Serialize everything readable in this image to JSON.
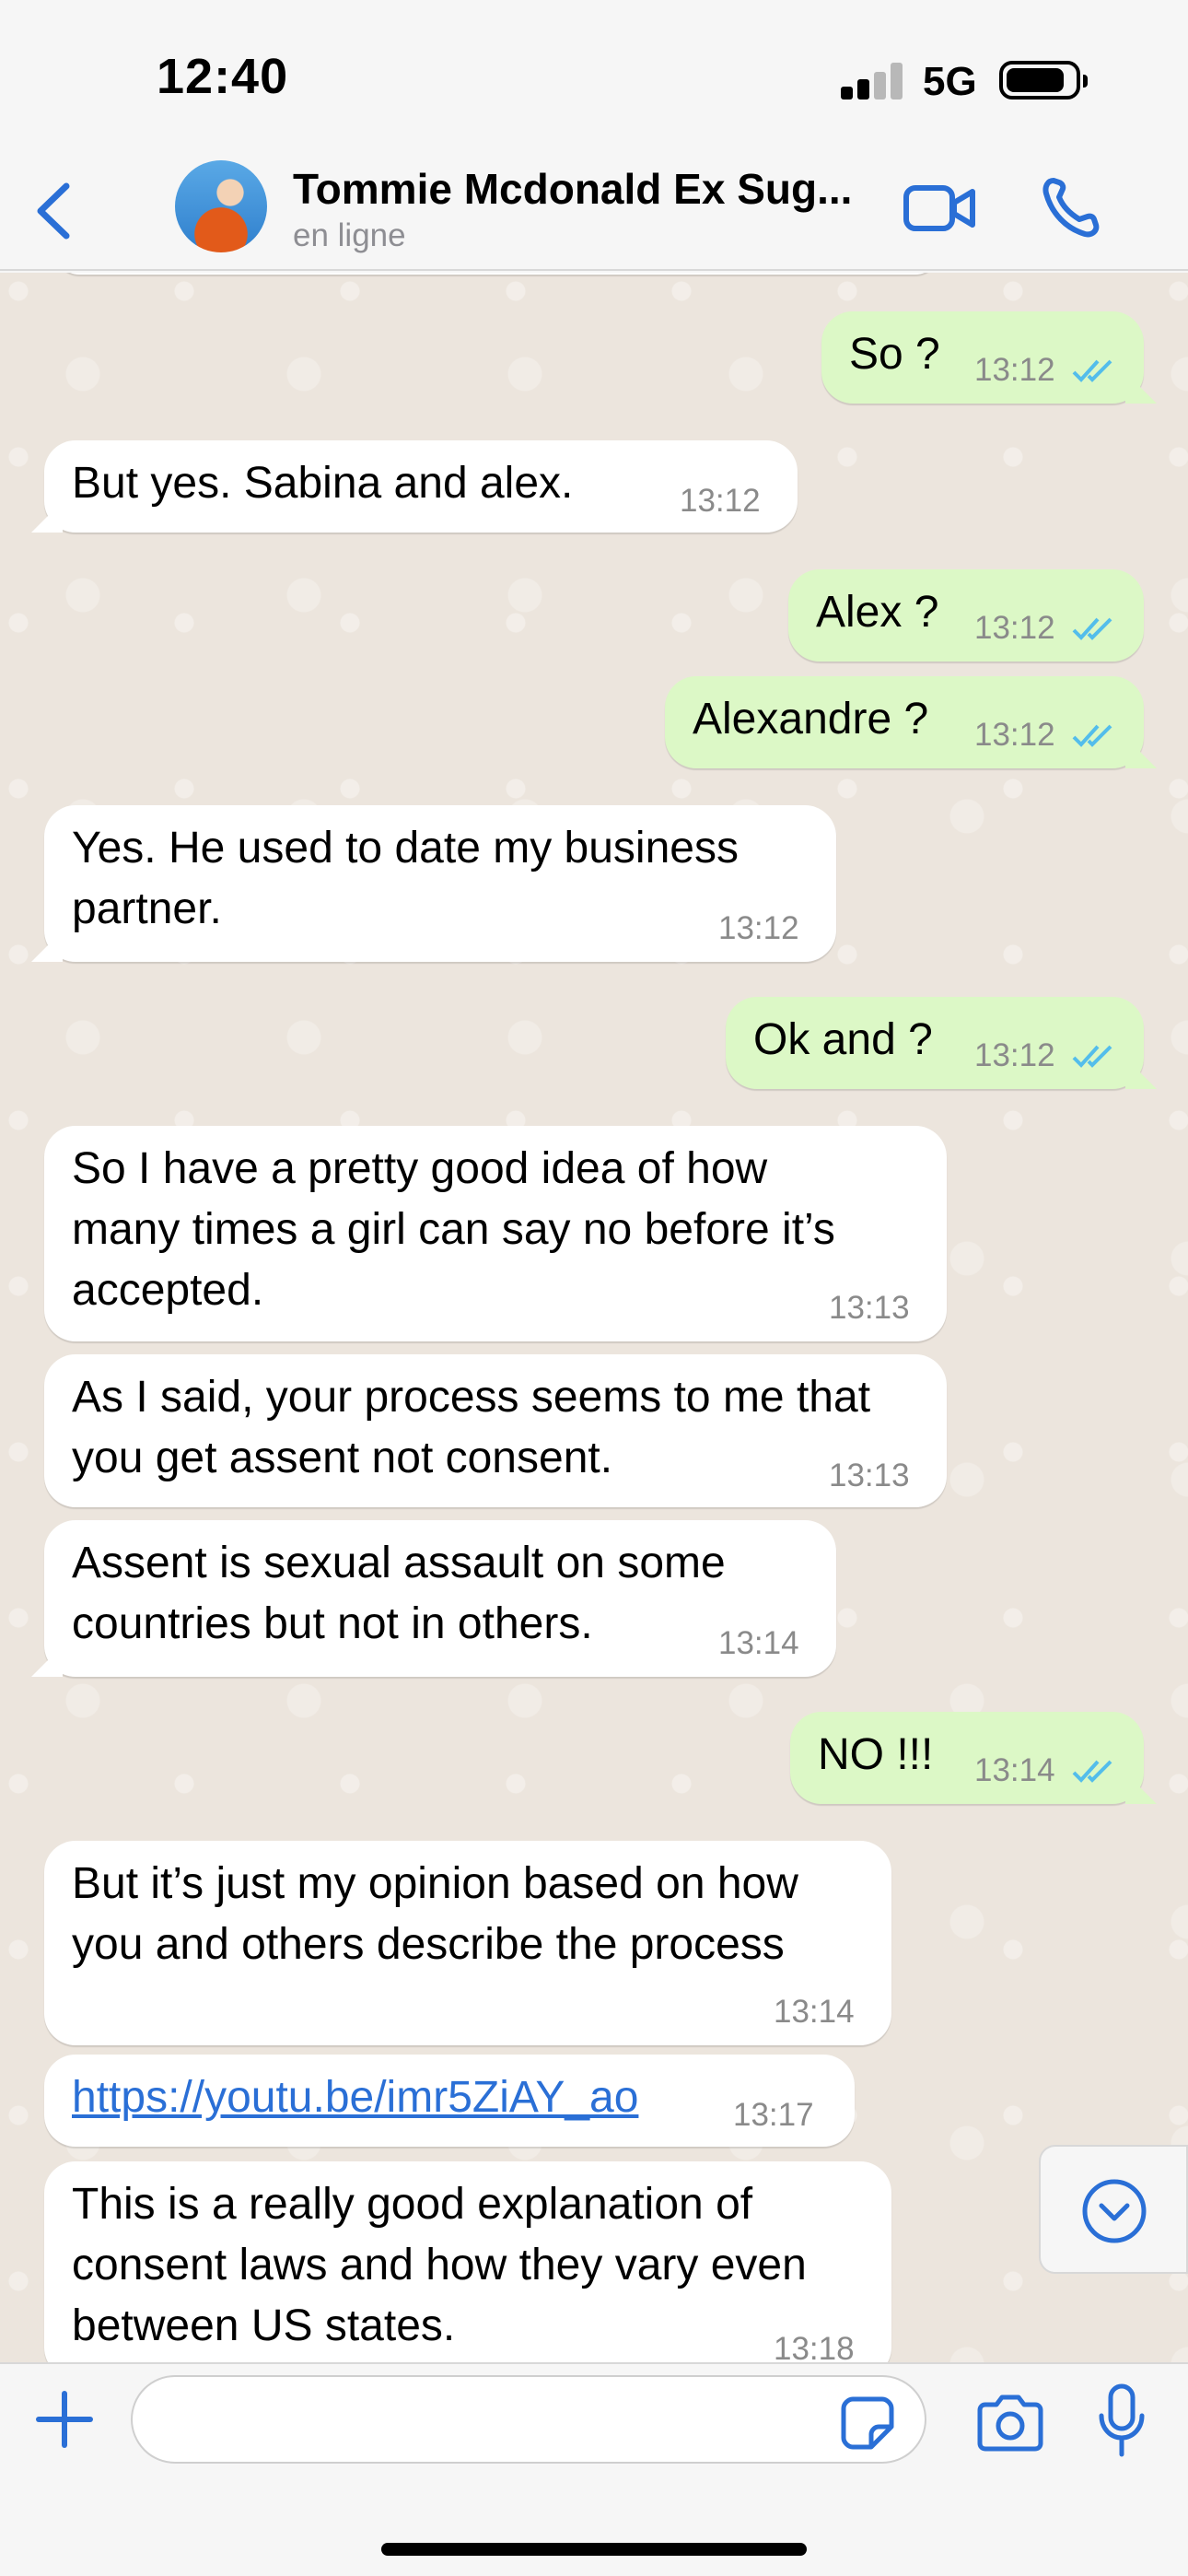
{
  "status_bar": {
    "time": "12:40",
    "network": "5G"
  },
  "header": {
    "contact_name": "Tommie  Mcdonald Ex Sug...",
    "contact_status": "en ligne"
  },
  "messages": [
    {
      "direction": "out",
      "text": "So ?",
      "time": "13:12",
      "read": true
    },
    {
      "direction": "in",
      "text": "But yes. Sabina and alex.",
      "time": "13:12"
    },
    {
      "direction": "out",
      "text": "Alex ?",
      "time": "13:12",
      "read": true
    },
    {
      "direction": "out",
      "text": "Alexandre ?",
      "time": "13:12",
      "read": true
    },
    {
      "direction": "in",
      "lines": [
        "Yes. He used to date my business",
        "partner."
      ],
      "time": "13:12"
    },
    {
      "direction": "out",
      "text": "Ok and ?",
      "time": "13:12",
      "read": true
    },
    {
      "direction": "in",
      "lines": [
        "So I have a pretty good idea of how",
        "many times a girl can say no before it’s",
        "accepted."
      ],
      "time": "13:13"
    },
    {
      "direction": "in",
      "lines": [
        "As I said, your process seems to me that",
        "you get assent not consent."
      ],
      "time": "13:13"
    },
    {
      "direction": "in",
      "lines": [
        "Assent is sexual assault on some",
        "countries but not in others."
      ],
      "time": "13:14"
    },
    {
      "direction": "out",
      "text": "NO !!!",
      "time": "13:14",
      "read": true
    },
    {
      "direction": "in",
      "lines": [
        "But it’s just my opinion based on how",
        "you and others describe the process"
      ],
      "time": "13:14"
    },
    {
      "direction": "in",
      "text": "https://youtu.be/imr5ZiAY_ao",
      "time": "13:17",
      "is_link": true
    },
    {
      "direction": "in",
      "lines": [
        "This is a really good explanation of",
        "consent laws and how they vary even",
        "between US states."
      ],
      "time": "13:18"
    }
  ],
  "input": {
    "placeholder": ""
  },
  "colors": {
    "accent": "#2a6fd6",
    "outgoing_bubble": "#dcf8c6",
    "incoming_bubble": "#ffffff",
    "read_ticks": "#53bdeb"
  },
  "icons": {
    "back": "chevron-left-icon",
    "video": "video-camera-icon",
    "call": "phone-icon",
    "scroll_down": "chevron-down-circle-icon",
    "add": "plus-icon",
    "sticker": "sticker-icon",
    "camera": "camera-icon",
    "mic": "microphone-icon"
  }
}
